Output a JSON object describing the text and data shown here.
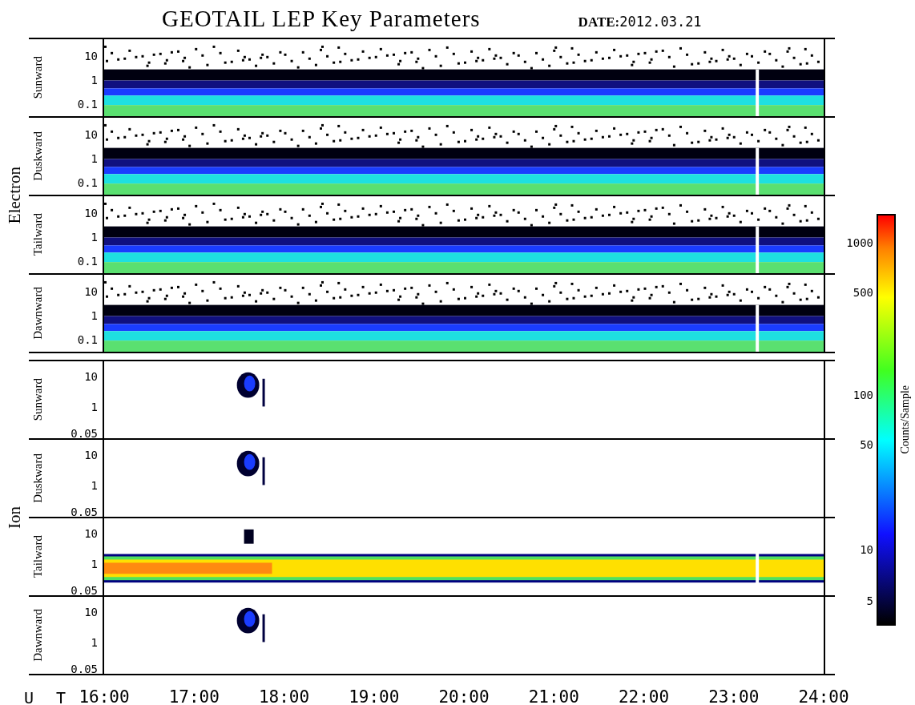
{
  "title": "GEOTAIL LEP Key Parameters",
  "date": {
    "label": "DATE:",
    "value": "2012.03.21"
  },
  "groups": [
    {
      "label": "Electron",
      "panels": [
        {
          "label": "Sunward",
          "kind": "electron",
          "yticks": [
            "10",
            "1",
            "0.1"
          ]
        },
        {
          "label": "Duskward",
          "kind": "electron",
          "yticks": [
            "10",
            "1",
            "0.1"
          ]
        },
        {
          "label": "Tailward",
          "kind": "electron",
          "yticks": [
            "10",
            "1",
            "0.1"
          ]
        },
        {
          "label": "Dawnward",
          "kind": "electron",
          "yticks": [
            "10",
            "1",
            "0.1"
          ]
        }
      ]
    },
    {
      "label": "Ion",
      "panels": [
        {
          "label": "Sunward",
          "kind": "blob",
          "yticks": [
            "10",
            "1",
            "0.05"
          ]
        },
        {
          "label": "Duskward",
          "kind": "blob",
          "yticks": [
            "10",
            "1",
            "0.05"
          ]
        },
        {
          "label": "Tailward",
          "kind": "band",
          "yticks": [
            "10",
            "1",
            "0.05"
          ]
        },
        {
          "label": "Dawnward",
          "kind": "blob",
          "yticks": [
            "10",
            "1",
            "0.05"
          ]
        }
      ]
    }
  ],
  "xaxis": {
    "label": "U T",
    "ticks": [
      "16:00",
      "17:00",
      "18:00",
      "19:00",
      "20:00",
      "21:00",
      "22:00",
      "23:00",
      "24:00"
    ]
  },
  "colorbar": {
    "label": "Counts/Sample",
    "ticks": [
      "1000",
      "500",
      "100",
      "50",
      "10",
      "5"
    ]
  }
}
